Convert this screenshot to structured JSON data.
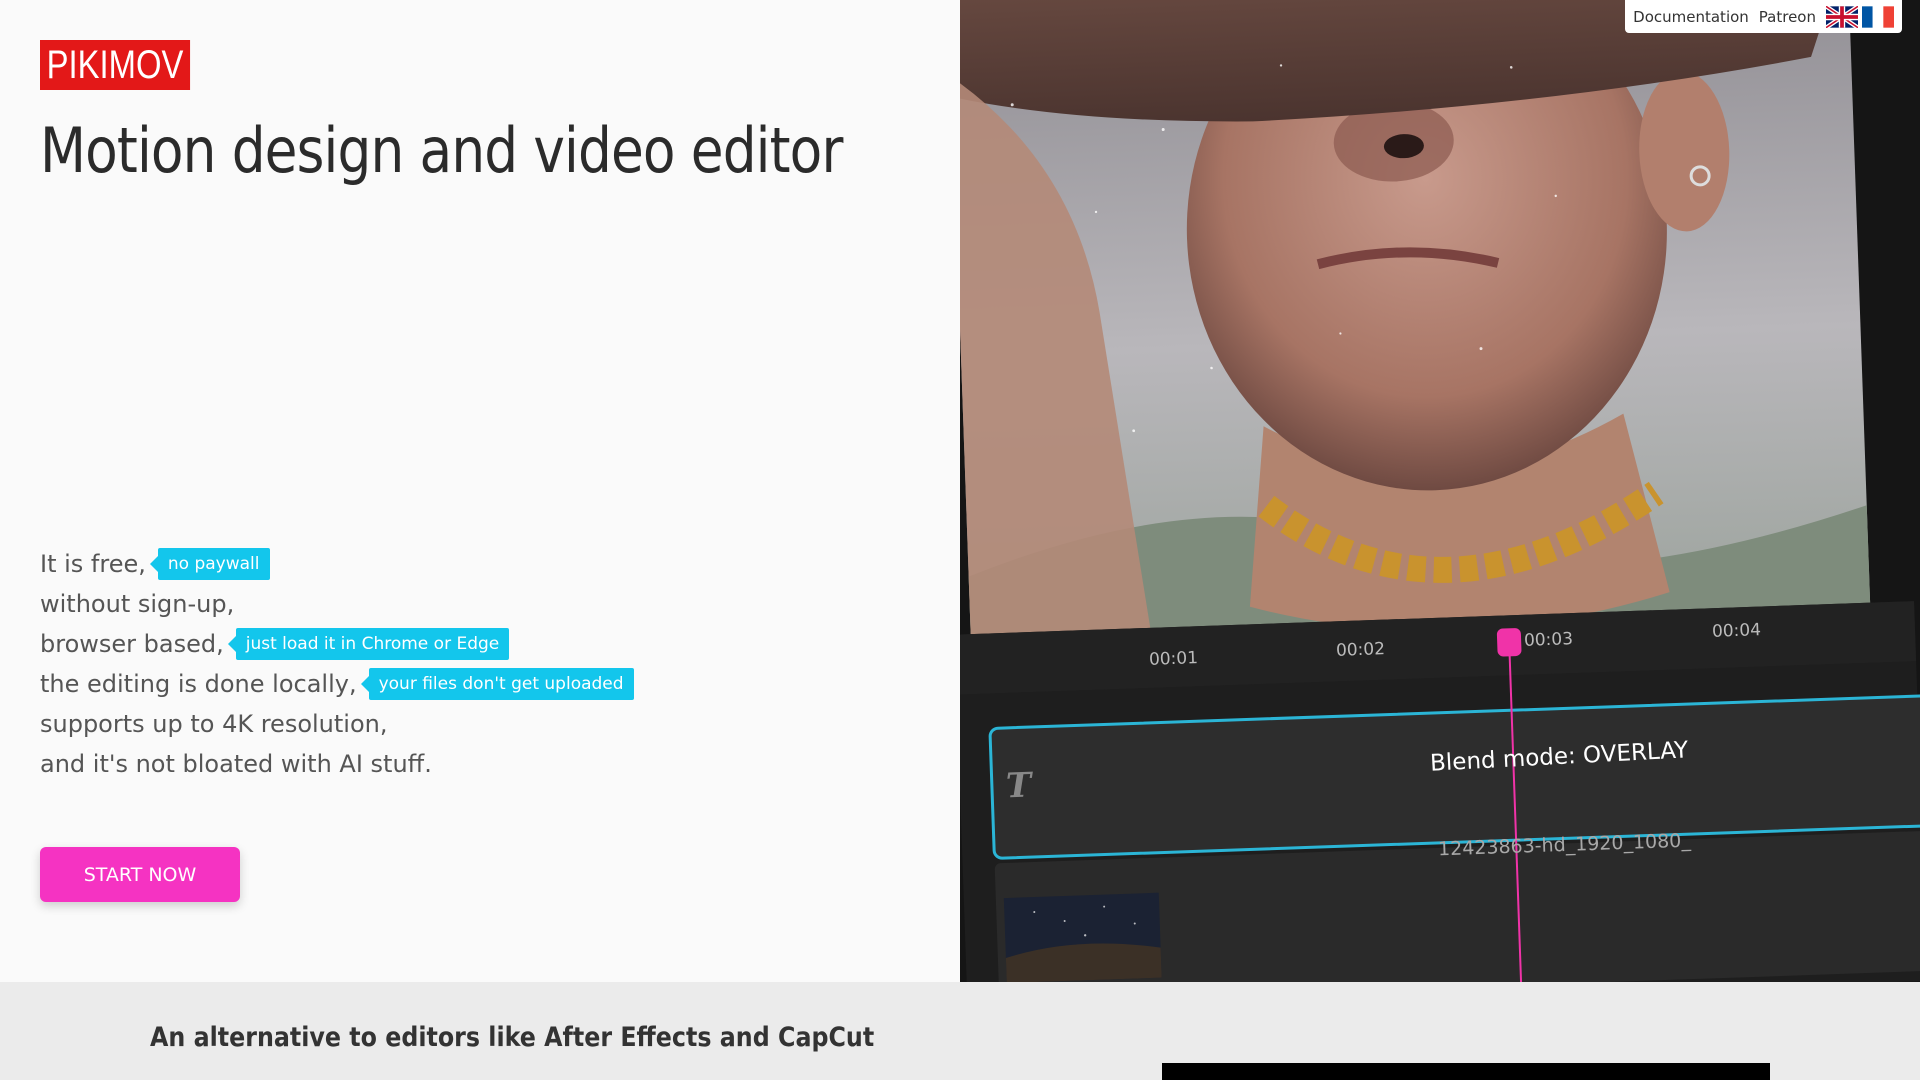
{
  "brand": {
    "logo_text": "PIKIMOV",
    "logo_color": "#e31818"
  },
  "hero": {
    "title": "Motion design and video editor",
    "features": [
      {
        "text": "It is free,",
        "tag": "no paywall"
      },
      {
        "text": "without sign-up,",
        "tag": null
      },
      {
        "text": "browser based,",
        "tag": "just load it in Chrome or Edge"
      },
      {
        "text": "the editing is done locally,",
        "tag": "your files don't get uploaded"
      },
      {
        "text": "supports up to 4K resolution,",
        "tag": null
      },
      {
        "text": "and it's not bloated with AI stuff.",
        "tag": null
      }
    ],
    "cta_label": "START NOW",
    "cta_color": "#f533c2",
    "tag_color": "#13c6ec"
  },
  "nav": {
    "documentation": "Documentation",
    "patreon": "Patreon",
    "languages": [
      "uk-flag-icon",
      "fr-flag-icon"
    ]
  },
  "preview": {
    "timeline_ticks": [
      "00:01",
      "00:02",
      "00:03",
      "00:04"
    ],
    "text_clip_icon": "T",
    "text_clip_label": "Blend mode: OVERLAY",
    "video_clip_label": "12423863-hd_1920_1080_",
    "playhead_color": "#f033a8",
    "clip_border_color": "#2bb5d6"
  },
  "section_two": {
    "heading": "An alternative to editors like After Effects and CapCut"
  }
}
